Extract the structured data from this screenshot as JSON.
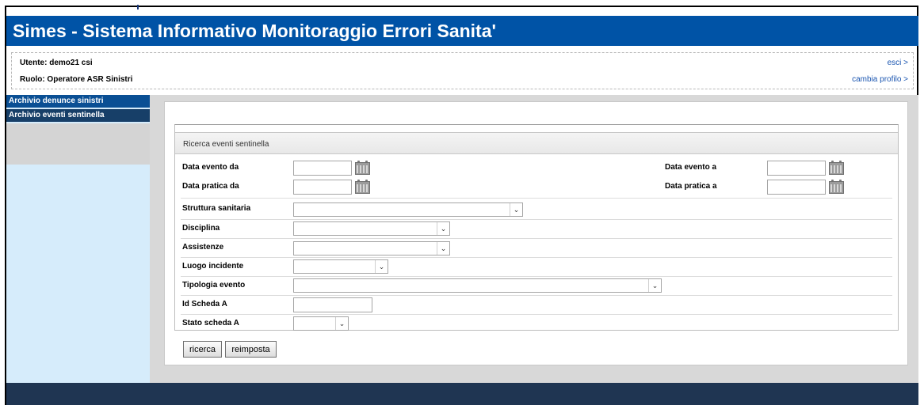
{
  "app": {
    "title": "Simes - Sistema Informativo Monitoraggio Errori Sanita'"
  },
  "user": {
    "utente_label": "Utente: demo21 csi",
    "ruolo_label": "Ruolo: Operatore ASR Sinistri",
    "logout_link": "esci >",
    "change_profile_link": "cambia profilo >"
  },
  "sidebar": {
    "items": [
      {
        "label": "Archivio denunce sinistri"
      },
      {
        "label": "Archivio eventi sentinella"
      }
    ]
  },
  "form": {
    "heading": "Ricerca eventi sentinella",
    "data_evento_da": {
      "label": "Data evento da",
      "value": ""
    },
    "data_evento_a": {
      "label": "Data evento a",
      "value": ""
    },
    "data_pratica_da": {
      "label": "Data pratica da",
      "value": ""
    },
    "data_pratica_a": {
      "label": "Data pratica a",
      "value": ""
    },
    "struttura_sanitaria": {
      "label": "Struttura sanitaria",
      "selected": ""
    },
    "disciplina": {
      "label": "Disciplina",
      "selected": ""
    },
    "assistenze": {
      "label": "Assistenze",
      "selected": ""
    },
    "luogo_incidente": {
      "label": "Luogo incidente",
      "selected": ""
    },
    "tipologia_evento": {
      "label": "Tipologia evento",
      "selected": ""
    },
    "id_scheda_a": {
      "label": "Id Scheda A",
      "value": ""
    },
    "stato_scheda_a": {
      "label": "Stato scheda A",
      "selected": ""
    },
    "search_button": "ricerca",
    "reset_button": "reimposta"
  },
  "icons": {
    "calendar": "calendar-icon",
    "dropdown": "chevron-down-icon"
  },
  "colors": {
    "title_bar": "#0053a6",
    "sidebar_item": "#0a4f8c",
    "sidebar_bg": "#d6ecfb",
    "footer": "#1f3552",
    "link": "#1a55b0"
  }
}
